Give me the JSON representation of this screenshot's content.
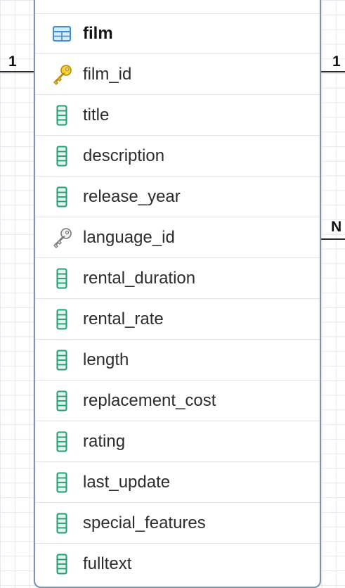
{
  "entity": {
    "name": "film",
    "name_icon": "table-icon",
    "columns": [
      {
        "name": "film_id",
        "icon": "primary-key-icon"
      },
      {
        "name": "title",
        "icon": "column-icon"
      },
      {
        "name": "description",
        "icon": "column-icon"
      },
      {
        "name": "release_year",
        "icon": "column-icon"
      },
      {
        "name": "language_id",
        "icon": "foreign-key-icon"
      },
      {
        "name": "rental_duration",
        "icon": "column-icon"
      },
      {
        "name": "rental_rate",
        "icon": "column-icon"
      },
      {
        "name": "length",
        "icon": "column-icon"
      },
      {
        "name": "replacement_cost",
        "icon": "column-icon"
      },
      {
        "name": "rating",
        "icon": "column-icon"
      },
      {
        "name": "last_update",
        "icon": "column-icon"
      },
      {
        "name": "special_features",
        "icon": "column-icon"
      },
      {
        "name": "fulltext",
        "icon": "column-icon"
      }
    ]
  },
  "relationships": [
    {
      "side": "left",
      "cardinality": "1",
      "column": "film_id"
    },
    {
      "side": "right",
      "cardinality": "1",
      "column": "film_id"
    },
    {
      "side": "right",
      "cardinality": "N",
      "column": "language_id"
    }
  ],
  "colors": {
    "entity_border": "#7f95ad",
    "table_icon": "#3b8ed8",
    "column_icon": "#1f9e75",
    "primary_key_icon": "#e8b90c",
    "foreign_key_icon": "#8a8a8a",
    "relationship_line": "#2b2b2b"
  }
}
